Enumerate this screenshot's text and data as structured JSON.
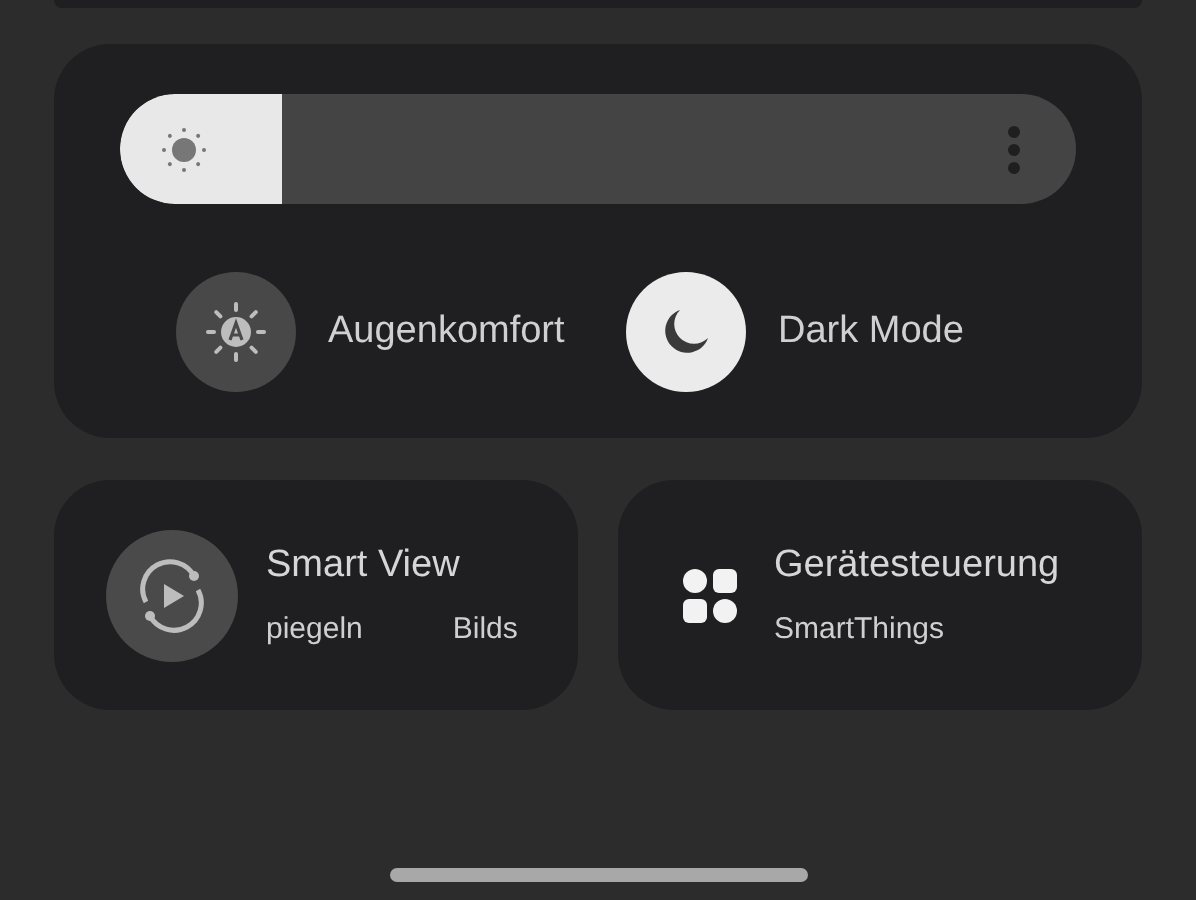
{
  "brightness": {
    "level": 0.17
  },
  "toggles": [
    {
      "label": "Augenkomfort",
      "kind": "eye-comfort",
      "on": false
    },
    {
      "label": "Dark Mode",
      "kind": "dark-mode",
      "on": true
    }
  ],
  "tiles": [
    {
      "kind": "smart-view",
      "title": "Smart View",
      "subtitle_parts": [
        "piegeln",
        "Bilds"
      ]
    },
    {
      "kind": "devices",
      "title": "Gerätesteuerung",
      "subtitle_parts": [
        "SmartThings"
      ]
    }
  ]
}
